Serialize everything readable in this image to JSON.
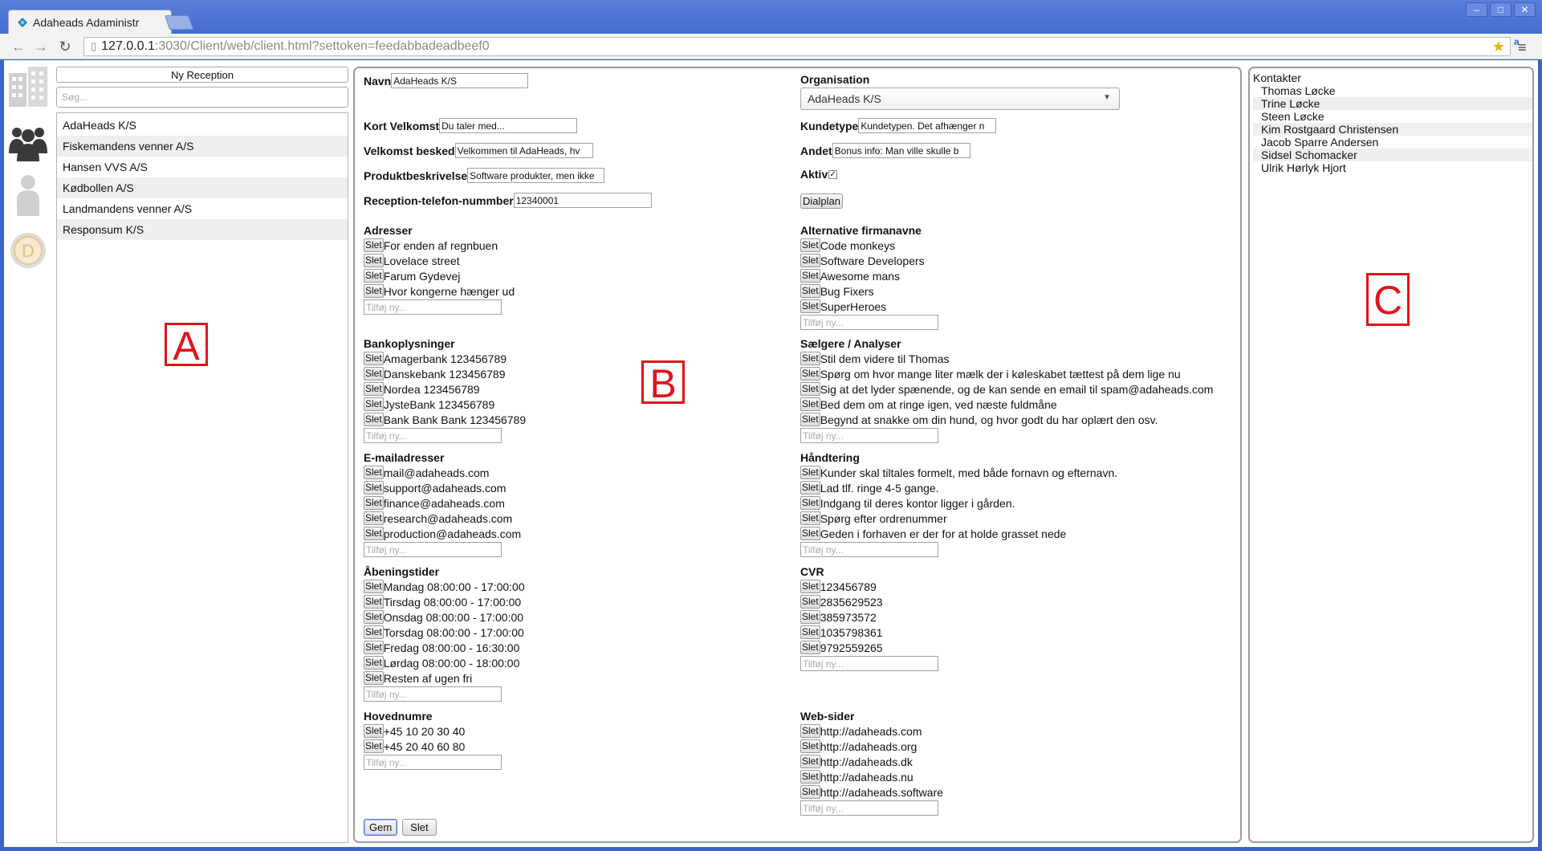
{
  "browser": {
    "tab_title": "Adaheads Adaministr",
    "url_host": "127.0.0.1",
    "url_rest": ":3030/Client/web/client.html?settoken=feedabbadeadbeef0"
  },
  "sidebar": {
    "icons": [
      "building-icon",
      "group-icon",
      "person-icon",
      "dialplan-icon"
    ],
    "dialplan_glyph": "D"
  },
  "panel_a": {
    "ny_reception_label": "Ny Reception",
    "search_placeholder": "Søg...",
    "clients": [
      "AdaHeads K/S",
      "Fiskemandens venner A/S",
      "Hansen VVS A/S",
      "Kødbollen A/S",
      "Landmandens venner A/S",
      "Responsum K/S"
    ]
  },
  "panel_b": {
    "navn_label": "Navn",
    "navn_value": "AdaHeads K/S",
    "kort_velkomst_label": "Kort Velkomst",
    "kort_velkomst_value": "Du taler med...",
    "velkomst_label": "Velkomst besked",
    "velkomst_value": "Velkommen til AdaHeads, hv",
    "produkt_label": "Produktbeskrivelse",
    "produkt_value": "Software produkter, men ikke",
    "telefon_label": "Reception-telefon-nummber",
    "telefon_value": "12340001",
    "organisation_label": "Organisation",
    "organisation_value": "AdaHeads K/S",
    "kundetype_label": "Kundetype",
    "kundetype_value": "Kundetypen. Det afhænger n",
    "andet_label": "Andet",
    "andet_value": "Bonus info: Man ville skulle b",
    "aktiv_label": "Aktiv",
    "aktiv_mark": "✓",
    "dialplan_label": "Dialplan",
    "slet_label": "Slet",
    "add_placeholder": "Tilføj ny...",
    "adresser": {
      "title": "Adresser",
      "items": [
        "For enden af regnbuen",
        "Lovelace street",
        "Farum Gydevej",
        "Hvor kongerne hænger ud"
      ]
    },
    "bank": {
      "title": "Bankoplysninger",
      "items": [
        "Amagerbank 123456789",
        "Danskebank 123456789",
        "Nordea 123456789",
        "JysteBank 123456789",
        "Bank Bank Bank 123456789"
      ]
    },
    "email": {
      "title": "E-mailadresser",
      "items": [
        "mail@adaheads.com",
        "support@adaheads.com",
        "finance@adaheads.com",
        "research@adaheads.com",
        "production@adaheads.com"
      ]
    },
    "aabning": {
      "title": "Åbeningstider",
      "items": [
        "Mandag 08:00:00 - 17:00:00",
        "Tirsdag 08:00:00 - 17:00:00",
        "Onsdag 08:00:00 - 17:00:00",
        "Torsdag 08:00:00 - 17:00:00",
        "Fredag 08:00:00 - 16:30:00",
        "Lørdag 08:00:00 - 18:00:00",
        "Resten af ugen fri"
      ]
    },
    "hovednumre": {
      "title": "Hovednumre",
      "items": [
        "+45 10 20 30 40",
        "+45 20 40 60 80"
      ]
    },
    "alt_navne": {
      "title": "Alternative firmanavne",
      "items": [
        "Code monkeys",
        "Software Developers",
        "Awesome mans",
        "Bug Fixers",
        "SuperHeroes"
      ]
    },
    "saelgere": {
      "title": "Sælgere / Analyser",
      "items": [
        "Stil dem videre til Thomas",
        "Spørg om hvor mange liter mælk der i køleskabet tættest på dem lige nu",
        "Sig at det lyder spænende, og de kan sende en email til spam@adaheads.com",
        "Bed dem om at ringe igen, ved næste fuldmåne",
        "Begynd at snakke om din hund, og hvor godt du har oplært den osv."
      ]
    },
    "haandtering": {
      "title": "Håndtering",
      "items": [
        "Kunder skal tiltales formelt, med både fornavn og efternavn.",
        "Lad tlf. ringe 4-5 gange.",
        "Indgang til deres kontor ligger i gården.",
        "Spørg efter ordrenummer",
        "Geden i forhaven er der for at holde grasset nede"
      ]
    },
    "cvr": {
      "title": "CVR",
      "items": [
        "123456789",
        "2835629523",
        "385973572",
        "1035798361",
        "9792559265"
      ]
    },
    "websider": {
      "title": "Web-sider",
      "items": [
        "http://adaheads.com",
        "http://adaheads.org",
        "http://adaheads.dk",
        "http://adaheads.nu",
        "http://adaheads.software"
      ]
    },
    "gem_label": "Gem",
    "slet_button_label": "Slet"
  },
  "panel_c": {
    "title": "Kontakter",
    "contacts": [
      "Thomas Løcke",
      "Trine Løcke",
      "Steen Løcke",
      "Kim Rostgaard Christensen",
      "Jacob Sparre Andersen",
      "Sidsel Schomacker",
      "Ulrik Hørlyk Hjort"
    ]
  },
  "markers": {
    "a": "A",
    "b": "B",
    "c": "C"
  },
  "colors": {
    "marker": "#e0141b",
    "window_frame": "#3c63c6"
  }
}
